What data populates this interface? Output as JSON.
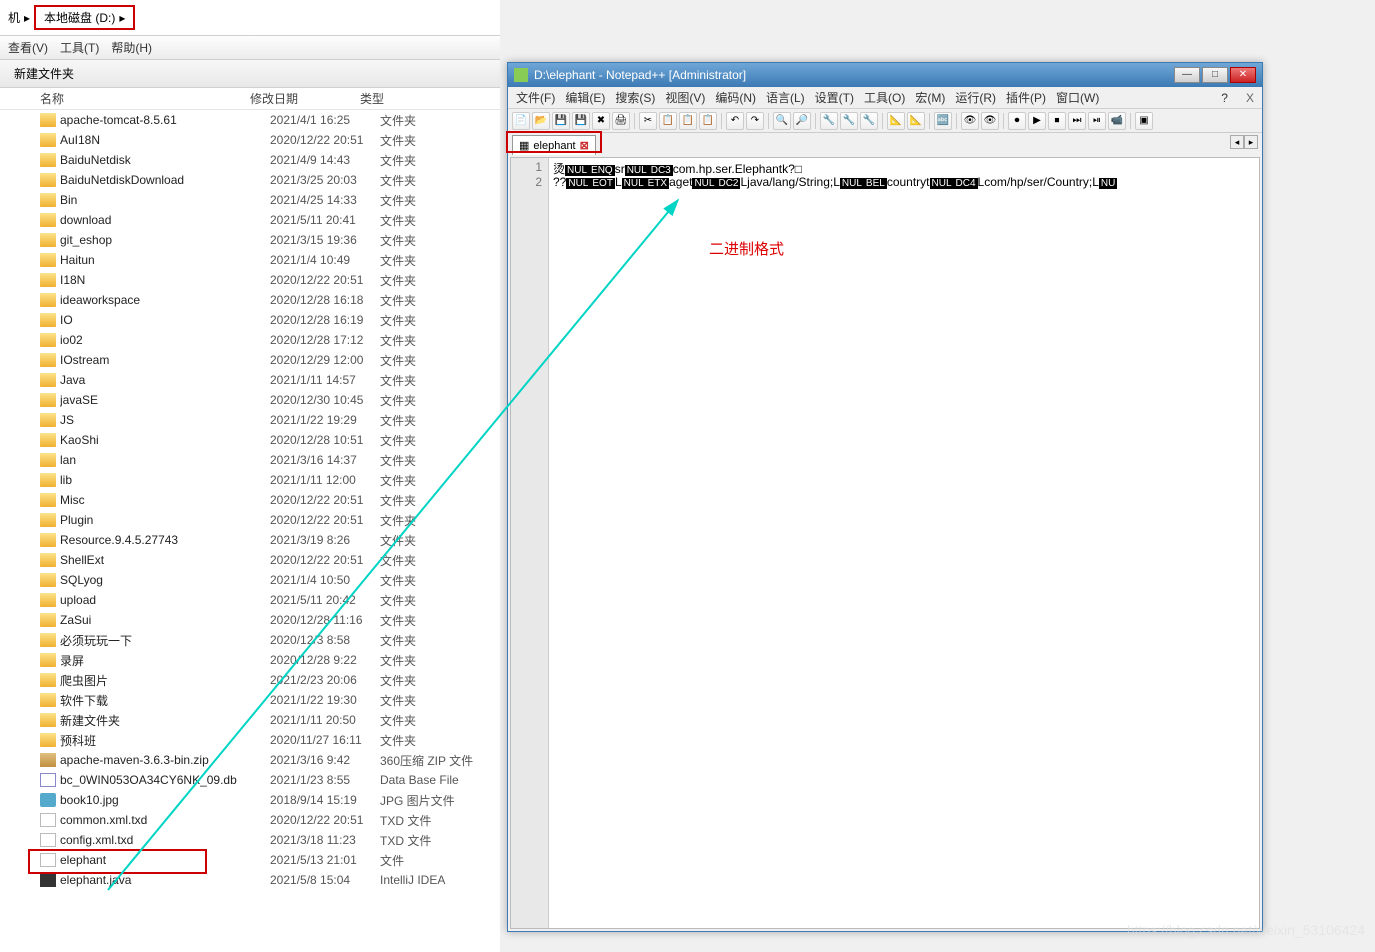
{
  "explorer": {
    "breadcrumb_host": "机",
    "breadcrumb_drive": "本地磁盘 (D:)",
    "menu": {
      "view": "查看(V)",
      "tools": "工具(T)",
      "help": "帮助(H)"
    },
    "toolbar": {
      "newfolder": "新建文件夹"
    },
    "cols": {
      "name": "名称",
      "date": "修改日期",
      "type": "类型"
    },
    "files": [
      {
        "icon": "folder",
        "name": "apache-tomcat-8.5.61",
        "date": "2021/4/1 16:25",
        "type": "文件夹"
      },
      {
        "icon": "folder",
        "name": "AuI18N",
        "date": "2020/12/22 20:51",
        "type": "文件夹"
      },
      {
        "icon": "folder",
        "name": "BaiduNetdisk",
        "date": "2021/4/9 14:43",
        "type": "文件夹"
      },
      {
        "icon": "folder",
        "name": "BaiduNetdiskDownload",
        "date": "2021/3/25 20:03",
        "type": "文件夹"
      },
      {
        "icon": "folder",
        "name": "Bin",
        "date": "2021/4/25 14:33",
        "type": "文件夹"
      },
      {
        "icon": "folder",
        "name": "download",
        "date": "2021/5/11 20:41",
        "type": "文件夹"
      },
      {
        "icon": "folder",
        "name": "git_eshop",
        "date": "2021/3/15 19:36",
        "type": "文件夹"
      },
      {
        "icon": "folder",
        "name": "Haitun",
        "date": "2021/1/4 10:49",
        "type": "文件夹"
      },
      {
        "icon": "folder",
        "name": "I18N",
        "date": "2020/12/22 20:51",
        "type": "文件夹"
      },
      {
        "icon": "folder",
        "name": "ideaworkspace",
        "date": "2020/12/28 16:18",
        "type": "文件夹"
      },
      {
        "icon": "folder",
        "name": "IO",
        "date": "2020/12/28 16:19",
        "type": "文件夹"
      },
      {
        "icon": "folder",
        "name": "io02",
        "date": "2020/12/28 17:12",
        "type": "文件夹"
      },
      {
        "icon": "folder",
        "name": "IOstream",
        "date": "2020/12/29 12:00",
        "type": "文件夹"
      },
      {
        "icon": "folder",
        "name": "Java",
        "date": "2021/1/11 14:57",
        "type": "文件夹"
      },
      {
        "icon": "folder",
        "name": "javaSE",
        "date": "2020/12/30 10:45",
        "type": "文件夹"
      },
      {
        "icon": "folder",
        "name": "JS",
        "date": "2021/1/22 19:29",
        "type": "文件夹"
      },
      {
        "icon": "folder",
        "name": "KaoShi",
        "date": "2020/12/28 10:51",
        "type": "文件夹"
      },
      {
        "icon": "folder",
        "name": "lan",
        "date": "2021/3/16 14:37",
        "type": "文件夹"
      },
      {
        "icon": "folder",
        "name": "lib",
        "date": "2021/1/11 12:00",
        "type": "文件夹"
      },
      {
        "icon": "folder",
        "name": "Misc",
        "date": "2020/12/22 20:51",
        "type": "文件夹"
      },
      {
        "icon": "folder",
        "name": "Plugin",
        "date": "2020/12/22 20:51",
        "type": "文件夹"
      },
      {
        "icon": "folder",
        "name": "Resource.9.4.5.27743",
        "date": "2021/3/19 8:26",
        "type": "文件夹"
      },
      {
        "icon": "folder",
        "name": "ShellExt",
        "date": "2020/12/22 20:51",
        "type": "文件夹"
      },
      {
        "icon": "folder",
        "name": "SQLyog",
        "date": "2021/1/4 10:50",
        "type": "文件夹"
      },
      {
        "icon": "folder",
        "name": "upload",
        "date": "2021/5/11 20:42",
        "type": "文件夹"
      },
      {
        "icon": "folder",
        "name": "ZaSui",
        "date": "2020/12/28 11:16",
        "type": "文件夹"
      },
      {
        "icon": "folder",
        "name": "必须玩玩一下",
        "date": "2020/12/3 8:58",
        "type": "文件夹"
      },
      {
        "icon": "folder",
        "name": "录屏",
        "date": "2020/12/28 9:22",
        "type": "文件夹"
      },
      {
        "icon": "folder",
        "name": "爬虫图片",
        "date": "2021/2/23 20:06",
        "type": "文件夹"
      },
      {
        "icon": "folder",
        "name": "软件下载",
        "date": "2021/1/22 19:30",
        "type": "文件夹"
      },
      {
        "icon": "folder",
        "name": "新建文件夹",
        "date": "2021/1/11 20:50",
        "type": "文件夹"
      },
      {
        "icon": "folder",
        "name": "预科班",
        "date": "2020/11/27 16:11",
        "type": "文件夹"
      },
      {
        "icon": "zip",
        "name": "apache-maven-3.6.3-bin.zip",
        "date": "2021/3/16 9:42",
        "type": "360压缩 ZIP 文件"
      },
      {
        "icon": "db",
        "name": "bc_0WIN053OA34CY6NK_09.db",
        "date": "2021/1/23 8:55",
        "type": "Data Base File"
      },
      {
        "icon": "jpg",
        "name": "book10.jpg",
        "date": "2018/9/14 15:19",
        "type": "JPG 图片文件"
      },
      {
        "icon": "file",
        "name": "common.xml.txd",
        "date": "2020/12/22 20:51",
        "type": "TXD 文件"
      },
      {
        "icon": "file",
        "name": "config.xml.txd",
        "date": "2021/3/18 11:23",
        "type": "TXD 文件"
      },
      {
        "icon": "file",
        "name": "elephant",
        "date": "2021/5/13 21:01",
        "type": "文件",
        "hl": true
      },
      {
        "icon": "java",
        "name": "elephant.java",
        "date": "2021/5/8 15:04",
        "type": "IntelliJ IDEA"
      }
    ]
  },
  "npp": {
    "title": "D:\\elephant - Notepad++ [Administrator]",
    "menu": [
      "文件(F)",
      "编辑(E)",
      "搜索(S)",
      "视图(V)",
      "编码(N)",
      "语言(L)",
      "设置(T)",
      "工具(O)",
      "宏(M)",
      "运行(R)",
      "插件(P)",
      "窗口(W)"
    ],
    "tab": "elephant",
    "lines": {
      "l1": {
        "pre": "烫",
        "n1": "NUL",
        "n2": "ENQ",
        "t1": "sr",
        "n3": "NUL",
        "n4": "DC3",
        "t2": "com.hp.ser.Elephantk?□"
      },
      "l2": {
        "pre": "??",
        "n1": "NUL",
        "n2": "EOT",
        "t1": "L",
        "n3": "NUL",
        "n4": "ETX",
        "t2": "aget",
        "n5": "NUL",
        "n6": "DC2",
        "t3": "Ljava/lang/String;L",
        "n7": "NUL",
        "n8": "BEL",
        "t4": "countryt",
        "n9": "NUL",
        "n10": "DC4",
        "t5": "Lcom/hp/ser/Country;L",
        "n11": "NU"
      }
    },
    "annot": "二进制格式"
  },
  "wbtns": {
    "min": "—",
    "max": "□",
    "close": "✕"
  },
  "watermark": "https://blog.csdn.net/weixin_53106424"
}
